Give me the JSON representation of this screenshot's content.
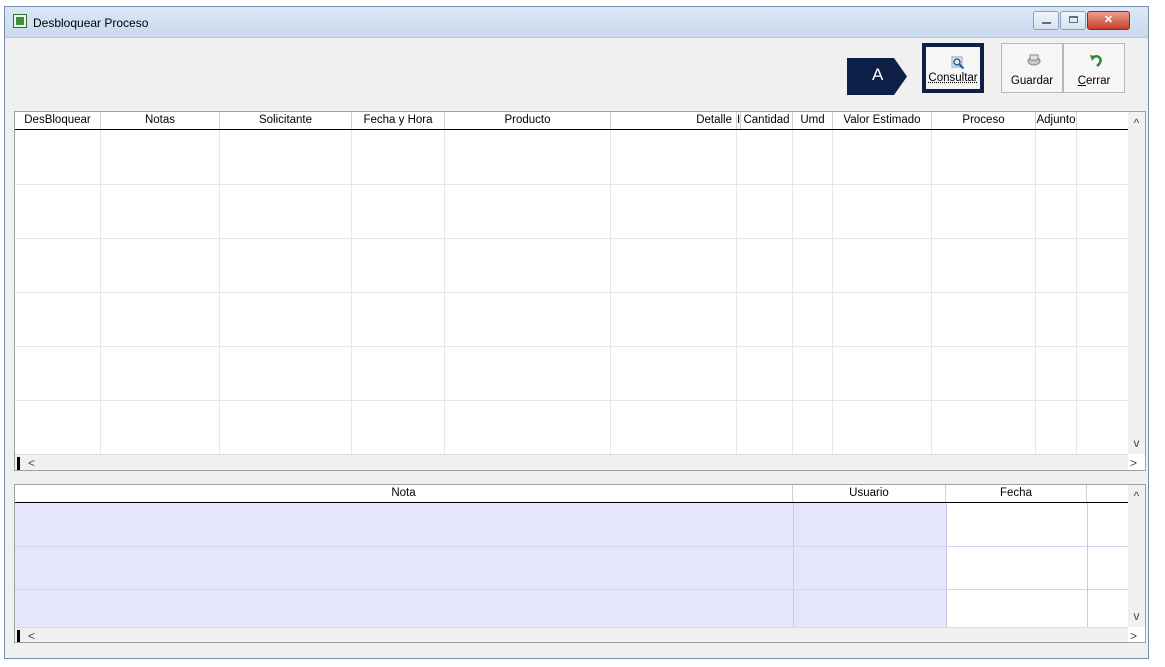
{
  "window": {
    "title": "Desbloquear Proceso",
    "controls": {
      "minimize": "▭",
      "maximize": "□",
      "close": "✕"
    }
  },
  "toolbar": {
    "buttons": [
      {
        "label": "Consultar",
        "icon": "magnifier-icon"
      },
      {
        "label": "Guardar",
        "icon": "save-icon"
      },
      {
        "label": "Cerrar",
        "icon": "undo-arrow-icon"
      }
    ],
    "callout": "A",
    "callout_color": "#0e1f47"
  },
  "top_grid": {
    "columns": [
      "DesBloquear",
      "Notas",
      "Solicitante",
      "Fecha y Hora",
      "Producto",
      "Detalle",
      "I",
      "Cantidad",
      "Umd",
      "Valor Estimado",
      "Proceso",
      "Adjunto"
    ],
    "rows": []
  },
  "bottom_grid": {
    "columns": [
      "Nota",
      "Usuario",
      "Fecha"
    ],
    "rows": [],
    "row_color": "#e6e6fb"
  },
  "scroll": {
    "up": "^",
    "down": "v",
    "left": "<",
    "right": ">"
  }
}
